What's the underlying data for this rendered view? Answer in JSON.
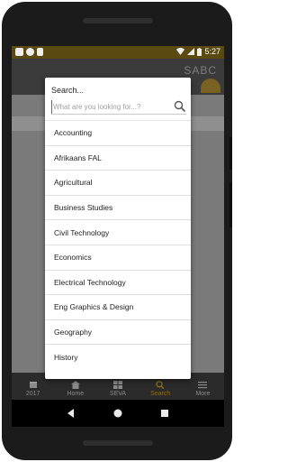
{
  "statusbar": {
    "time": "5:27"
  },
  "appbar": {
    "logo": "SABC"
  },
  "dialog": {
    "title": "Search...",
    "search_placeholder": "What are you looking for...?",
    "subjects": [
      "Accounting",
      "Afrikaans FAL",
      "Agricultural",
      "Business Studies",
      "Civil Technology",
      "Economics",
      "Electrical Technology",
      "Eng Graphics & Design",
      "Geography",
      "History"
    ]
  },
  "bottomnav": {
    "items": [
      {
        "label": "2017",
        "icon": "calendar-icon",
        "active": false
      },
      {
        "label": "Home",
        "icon": "home-icon",
        "active": false
      },
      {
        "label": "SEVA",
        "icon": "grid-icon",
        "active": false
      },
      {
        "label": "Search",
        "icon": "search-icon",
        "active": true
      },
      {
        "label": "More",
        "icon": "menu-icon",
        "active": false
      }
    ]
  },
  "colors": {
    "accent": "#8a6d1c",
    "statusbar": "#5a4a12"
  }
}
